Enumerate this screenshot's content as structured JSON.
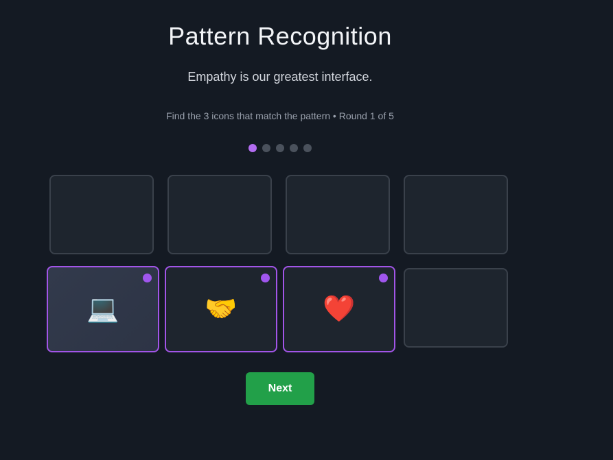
{
  "header": {
    "title": "Pattern Recognition",
    "subtitle": "Empathy is our greatest interface.",
    "instruction": "Find the 3 icons that match the pattern • Round 1 of 5"
  },
  "progress": {
    "current_round": 1,
    "total_rounds": 5
  },
  "tiles": [
    {
      "emoji": "",
      "selected": false
    },
    {
      "emoji": "",
      "selected": false
    },
    {
      "emoji": "",
      "selected": false
    },
    {
      "emoji": "",
      "selected": false
    },
    {
      "emoji": "💻",
      "icon": "laptop-icon",
      "selected": true
    },
    {
      "emoji": "🤝",
      "icon": "handshake-icon",
      "selected": true
    },
    {
      "emoji": "❤️",
      "icon": "heart-icon",
      "selected": true
    },
    {
      "emoji": "",
      "selected": false
    }
  ],
  "actions": {
    "next_label": "Next"
  },
  "colors": {
    "background": "#141a23",
    "accent": "#a255e8",
    "button": "#22a049"
  }
}
